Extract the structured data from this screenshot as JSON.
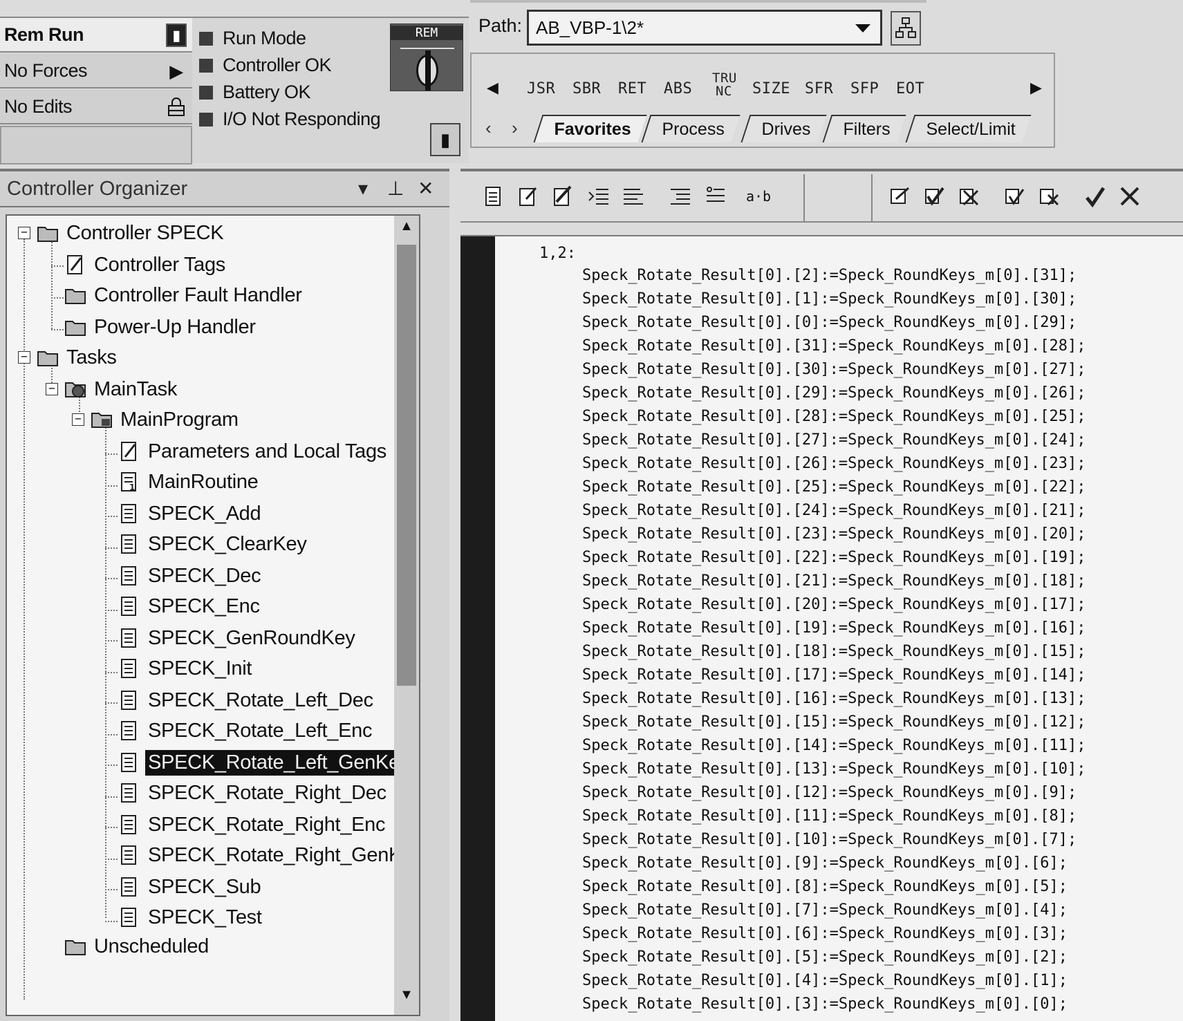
{
  "status": {
    "mode": "Rem Run",
    "forces": "No Forces",
    "edits": "No Edits",
    "indicators": [
      "Run Mode",
      "Controller OK",
      "Battery OK",
      "I/O Not Responding"
    ],
    "keyswitch_label": "REM"
  },
  "path": {
    "label": "Path:",
    "value": "AB_VBP-1\\2*"
  },
  "instructions": [
    "JSR",
    "SBR",
    "RET",
    "ABS",
    "TRU NC",
    "SIZE",
    "SFR",
    "SFP",
    "EOT"
  ],
  "palette_tabs": [
    "Favorites",
    "Process",
    "Drives",
    "Filters",
    "Select/Limit"
  ],
  "organizer": {
    "title": "Controller Organizer",
    "tree": [
      {
        "label": "Controller SPECK",
        "icon": "folder"
      },
      {
        "label": "Controller Tags",
        "icon": "tags"
      },
      {
        "label": "Controller Fault Handler",
        "icon": "folder"
      },
      {
        "label": "Power-Up Handler",
        "icon": "folder"
      },
      {
        "label": "Tasks",
        "icon": "folder"
      },
      {
        "label": "MainTask",
        "icon": "task"
      },
      {
        "label": "MainProgram",
        "icon": "program"
      },
      {
        "label": "Parameters and Local Tags",
        "icon": "tags"
      },
      {
        "label": "MainRoutine",
        "icon": "main-routine"
      },
      {
        "label": "SPECK_Add",
        "icon": "routine"
      },
      {
        "label": "SPECK_ClearKey",
        "icon": "routine"
      },
      {
        "label": "SPECK_Dec",
        "icon": "routine"
      },
      {
        "label": "SPECK_Enc",
        "icon": "routine"
      },
      {
        "label": "SPECK_GenRoundKey",
        "icon": "routine"
      },
      {
        "label": "SPECK_Init",
        "icon": "routine"
      },
      {
        "label": "SPECK_Rotate_Left_Dec",
        "icon": "routine"
      },
      {
        "label": "SPECK_Rotate_Left_Enc",
        "icon": "routine"
      },
      {
        "label": "SPECK_Rotate_Left_GenKey",
        "icon": "routine"
      },
      {
        "label": "SPECK_Rotate_Right_Dec",
        "icon": "routine"
      },
      {
        "label": "SPECK_Rotate_Right_Enc",
        "icon": "routine"
      },
      {
        "label": "SPECK_Rotate_Right_GenKey",
        "icon": "routine"
      },
      {
        "label": "SPECK_Sub",
        "icon": "routine"
      },
      {
        "label": "SPECK_Test",
        "icon": "routine"
      },
      {
        "label": "Unscheduled",
        "icon": "folder"
      }
    ],
    "selected": "SPECK_Rotate_Left_GenKey"
  },
  "editor": {
    "routine_label": "1,2:",
    "code_lines": [
      "Speck_Rotate_Result[0].[2]:=Speck_RoundKeys_m[0].[31];",
      "Speck_Rotate_Result[0].[1]:=Speck_RoundKeys_m[0].[30];",
      "Speck_Rotate_Result[0].[0]:=Speck_RoundKeys_m[0].[29];",
      "Speck_Rotate_Result[0].[31]:=Speck_RoundKeys_m[0].[28];",
      "Speck_Rotate_Result[0].[30]:=Speck_RoundKeys_m[0].[27];",
      "Speck_Rotate_Result[0].[29]:=Speck_RoundKeys_m[0].[26];",
      "Speck_Rotate_Result[0].[28]:=Speck_RoundKeys_m[0].[25];",
      "Speck_Rotate_Result[0].[27]:=Speck_RoundKeys_m[0].[24];",
      "Speck_Rotate_Result[0].[26]:=Speck_RoundKeys_m[0].[23];",
      "Speck_Rotate_Result[0].[25]:=Speck_RoundKeys_m[0].[22];",
      "Speck_Rotate_Result[0].[24]:=Speck_RoundKeys_m[0].[21];",
      "Speck_Rotate_Result[0].[23]:=Speck_RoundKeys_m[0].[20];",
      "Speck_Rotate_Result[0].[22]:=Speck_RoundKeys_m[0].[19];",
      "Speck_Rotate_Result[0].[21]:=Speck_RoundKeys_m[0].[18];",
      "Speck_Rotate_Result[0].[20]:=Speck_RoundKeys_m[0].[17];",
      "Speck_Rotate_Result[0].[19]:=Speck_RoundKeys_m[0].[16];",
      "Speck_Rotate_Result[0].[18]:=Speck_RoundKeys_m[0].[15];",
      "Speck_Rotate_Result[0].[17]:=Speck_RoundKeys_m[0].[14];",
      "Speck_Rotate_Result[0].[16]:=Speck_RoundKeys_m[0].[13];",
      "Speck_Rotate_Result[0].[15]:=Speck_RoundKeys_m[0].[12];",
      "Speck_Rotate_Result[0].[14]:=Speck_RoundKeys_m[0].[11];",
      "Speck_Rotate_Result[0].[13]:=Speck_RoundKeys_m[0].[10];",
      "Speck_Rotate_Result[0].[12]:=Speck_RoundKeys_m[0].[9];",
      "Speck_Rotate_Result[0].[11]:=Speck_RoundKeys_m[0].[8];",
      "Speck_Rotate_Result[0].[10]:=Speck_RoundKeys_m[0].[7];",
      "Speck_Rotate_Result[0].[9]:=Speck_RoundKeys_m[0].[6];",
      "Speck_Rotate_Result[0].[8]:=Speck_RoundKeys_m[0].[5];",
      "Speck_Rotate_Result[0].[7]:=Speck_RoundKeys_m[0].[4];",
      "Speck_Rotate_Result[0].[6]:=Speck_RoundKeys_m[0].[3];",
      "Speck_Rotate_Result[0].[5]:=Speck_RoundKeys_m[0].[2];",
      "Speck_Rotate_Result[0].[4]:=Speck_RoundKeys_m[0].[1];",
      "Speck_Rotate_Result[0].[3]:=Speck_RoundKeys_m[0].[0];"
    ]
  }
}
